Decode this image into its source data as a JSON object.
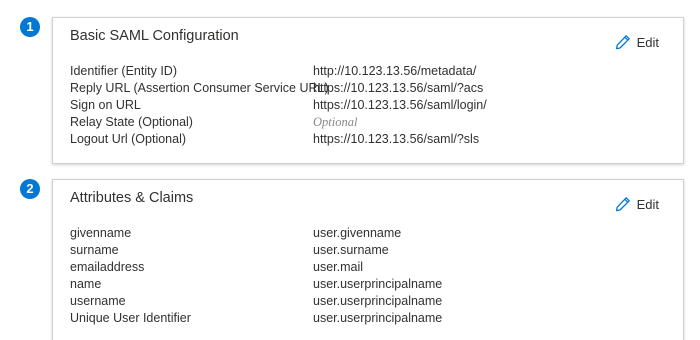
{
  "colors": {
    "accent": "#0078d4",
    "border": "#d2d0ce",
    "text": "#323130",
    "placeholder": "#8a8886"
  },
  "sections": [
    {
      "step": "1",
      "title": "Basic SAML Configuration",
      "edit_label": "Edit",
      "edit_icon": "pencil-icon",
      "rows": [
        {
          "label": "Identifier (Entity ID)",
          "value": "http://10.123.13.56/metadata/"
        },
        {
          "label": "Reply URL (Assertion Consumer Service URL)",
          "value": "https://10.123.13.56/saml/?acs"
        },
        {
          "label": "Sign on URL",
          "value": "https://10.123.13.56/saml/login/"
        },
        {
          "label": "Relay State (Optional)",
          "value": "Optional"
        },
        {
          "label": "Logout Url (Optional)",
          "value": "https://10.123.13.56/saml/?sls"
        }
      ]
    },
    {
      "step": "2",
      "title": "Attributes & Claims",
      "edit_label": "Edit",
      "edit_icon": "pencil-icon",
      "rows": [
        {
          "label": "givenname",
          "value": "user.givenname"
        },
        {
          "label": "surname",
          "value": "user.surname"
        },
        {
          "label": "emailaddress",
          "value": "user.mail"
        },
        {
          "label": "name",
          "value": "user.userprincipalname"
        },
        {
          "label": "username",
          "value": "user.userprincipalname"
        },
        {
          "label": "Unique User Identifier",
          "value": "user.userprincipalname"
        }
      ]
    }
  ]
}
